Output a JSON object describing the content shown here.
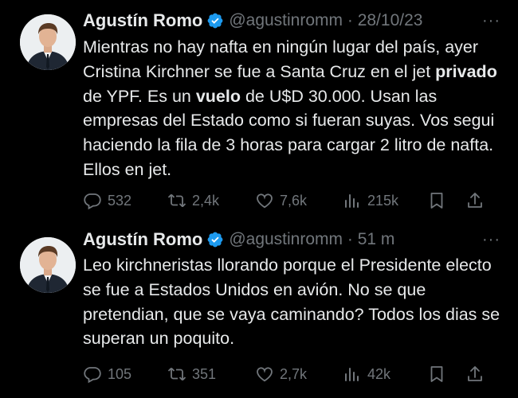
{
  "tweets": [
    {
      "name": "Agustín Romo",
      "handle": "@agustinromm",
      "sep": " · ",
      "time": "28/10/23",
      "more": "···",
      "body": [
        {
          "text": "Mientras no hay nafta en ningún lugar del país, ayer Cristina Kirchner se fue a Santa Cruz en el jet ",
          "bold": false
        },
        {
          "text": "privado",
          "bold": true
        },
        {
          "text": " de YPF. Es un ",
          "bold": false
        },
        {
          "text": "vuelo",
          "bold": true
        },
        {
          "text": " de U$D 30.000. Usan las empresas del Estado como si fueran suyas. Vos segui haciendo la fila de 3 horas para cargar 2 litro de nafta. Ellos en jet.",
          "bold": false
        }
      ],
      "replies": "532",
      "retweets": "2,4k",
      "likes": "7,6k",
      "views": "215k"
    },
    {
      "name": "Agustín Romo",
      "handle": "@agustinromm",
      "sep": " · ",
      "time": "51 m",
      "more": "···",
      "body": [
        {
          "text": "Leo kirchneristas llorando porque el Presidente electo se fue a Estados Unidos en avión. No se que pretendian, que se vaya caminando? Todos los dias se superan un poquito.",
          "bold": false
        }
      ],
      "replies": "105",
      "retweets": "351",
      "likes": "2,7k",
      "views": "42k"
    }
  ],
  "colors": {
    "background": "#000000",
    "text": "#e7e9ea",
    "muted": "#71767b",
    "verified": "#1d9bf0"
  },
  "icons": [
    "verified-badge-icon",
    "reply-icon",
    "retweet-icon",
    "like-icon",
    "views-icon",
    "bookmark-icon",
    "share-icon"
  ]
}
